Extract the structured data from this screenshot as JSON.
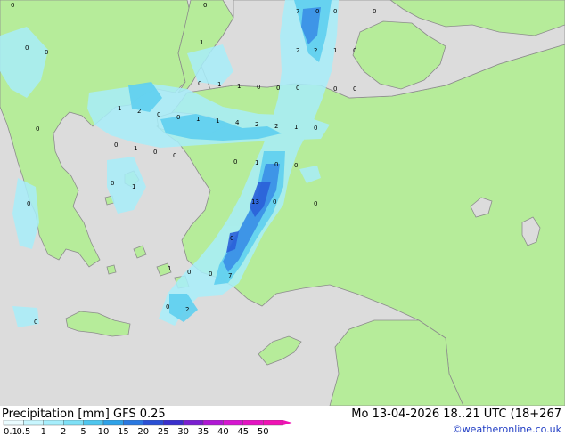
{
  "header": {
    "title_left": "Precipitation [mm]  GFS 0.25",
    "title_right": "Mo 13-04-2026 18..21 UTC (18+267",
    "credit": "©weatheronline.co.uk"
  },
  "colors": {
    "sea": "#dcdcdc",
    "land": "#b6ec9a",
    "coast": "#8c8c8c",
    "precip_light": "#a8eefa",
    "precip_mid": "#5fd0f0",
    "precip_heavy": "#3a8ee6",
    "precip_core": "#2a5fd8"
  },
  "legend": {
    "labels": [
      "0.1",
      "0.5",
      "1",
      "2",
      "5",
      "10",
      "15",
      "20",
      "25",
      "30",
      "35",
      "40",
      "45",
      "50"
    ],
    "colors": [
      "#eafcff",
      "#c8f6fe",
      "#a6eefc",
      "#7ee0f6",
      "#4fc6ee",
      "#2ea2e8",
      "#2a78e0",
      "#2a4fd4",
      "#3a2fcc",
      "#7a1fd0",
      "#b018d4",
      "#d616d0",
      "#e414c2",
      "#f012b4"
    ]
  },
  "map_labels": [
    {
      "text": "0"
    },
    {
      "text": "0"
    },
    {
      "text": "7"
    },
    {
      "text": "0"
    },
    {
      "text": "0"
    },
    {
      "text": "0"
    },
    {
      "text": "0"
    },
    {
      "text": "0"
    },
    {
      "text": "1"
    },
    {
      "text": "2"
    },
    {
      "text": "2"
    },
    {
      "text": "1"
    },
    {
      "text": "0"
    },
    {
      "text": "0"
    },
    {
      "text": "1"
    },
    {
      "text": "1"
    },
    {
      "text": "0"
    },
    {
      "text": "0"
    },
    {
      "text": "0"
    },
    {
      "text": "0"
    },
    {
      "text": "0"
    },
    {
      "text": "1"
    },
    {
      "text": "2"
    },
    {
      "text": "0"
    },
    {
      "text": "0"
    },
    {
      "text": "1"
    },
    {
      "text": "1"
    },
    {
      "text": "4"
    },
    {
      "text": "2"
    },
    {
      "text": "2"
    },
    {
      "text": "1"
    },
    {
      "text": "0"
    },
    {
      "text": "0"
    },
    {
      "text": "0"
    },
    {
      "text": "0"
    },
    {
      "text": "1"
    },
    {
      "text": "0"
    },
    {
      "text": "1"
    },
    {
      "text": "0"
    },
    {
      "text": "0"
    },
    {
      "text": "0"
    },
    {
      "text": "1"
    },
    {
      "text": "13"
    },
    {
      "text": "0"
    },
    {
      "text": "0"
    },
    {
      "text": "0"
    },
    {
      "text": "0"
    },
    {
      "text": "1"
    },
    {
      "text": "0"
    },
    {
      "text": "0"
    },
    {
      "text": "7"
    },
    {
      "text": "0"
    },
    {
      "text": "2"
    },
    {
      "text": "0"
    },
    {
      "text": "0"
    }
  ]
}
